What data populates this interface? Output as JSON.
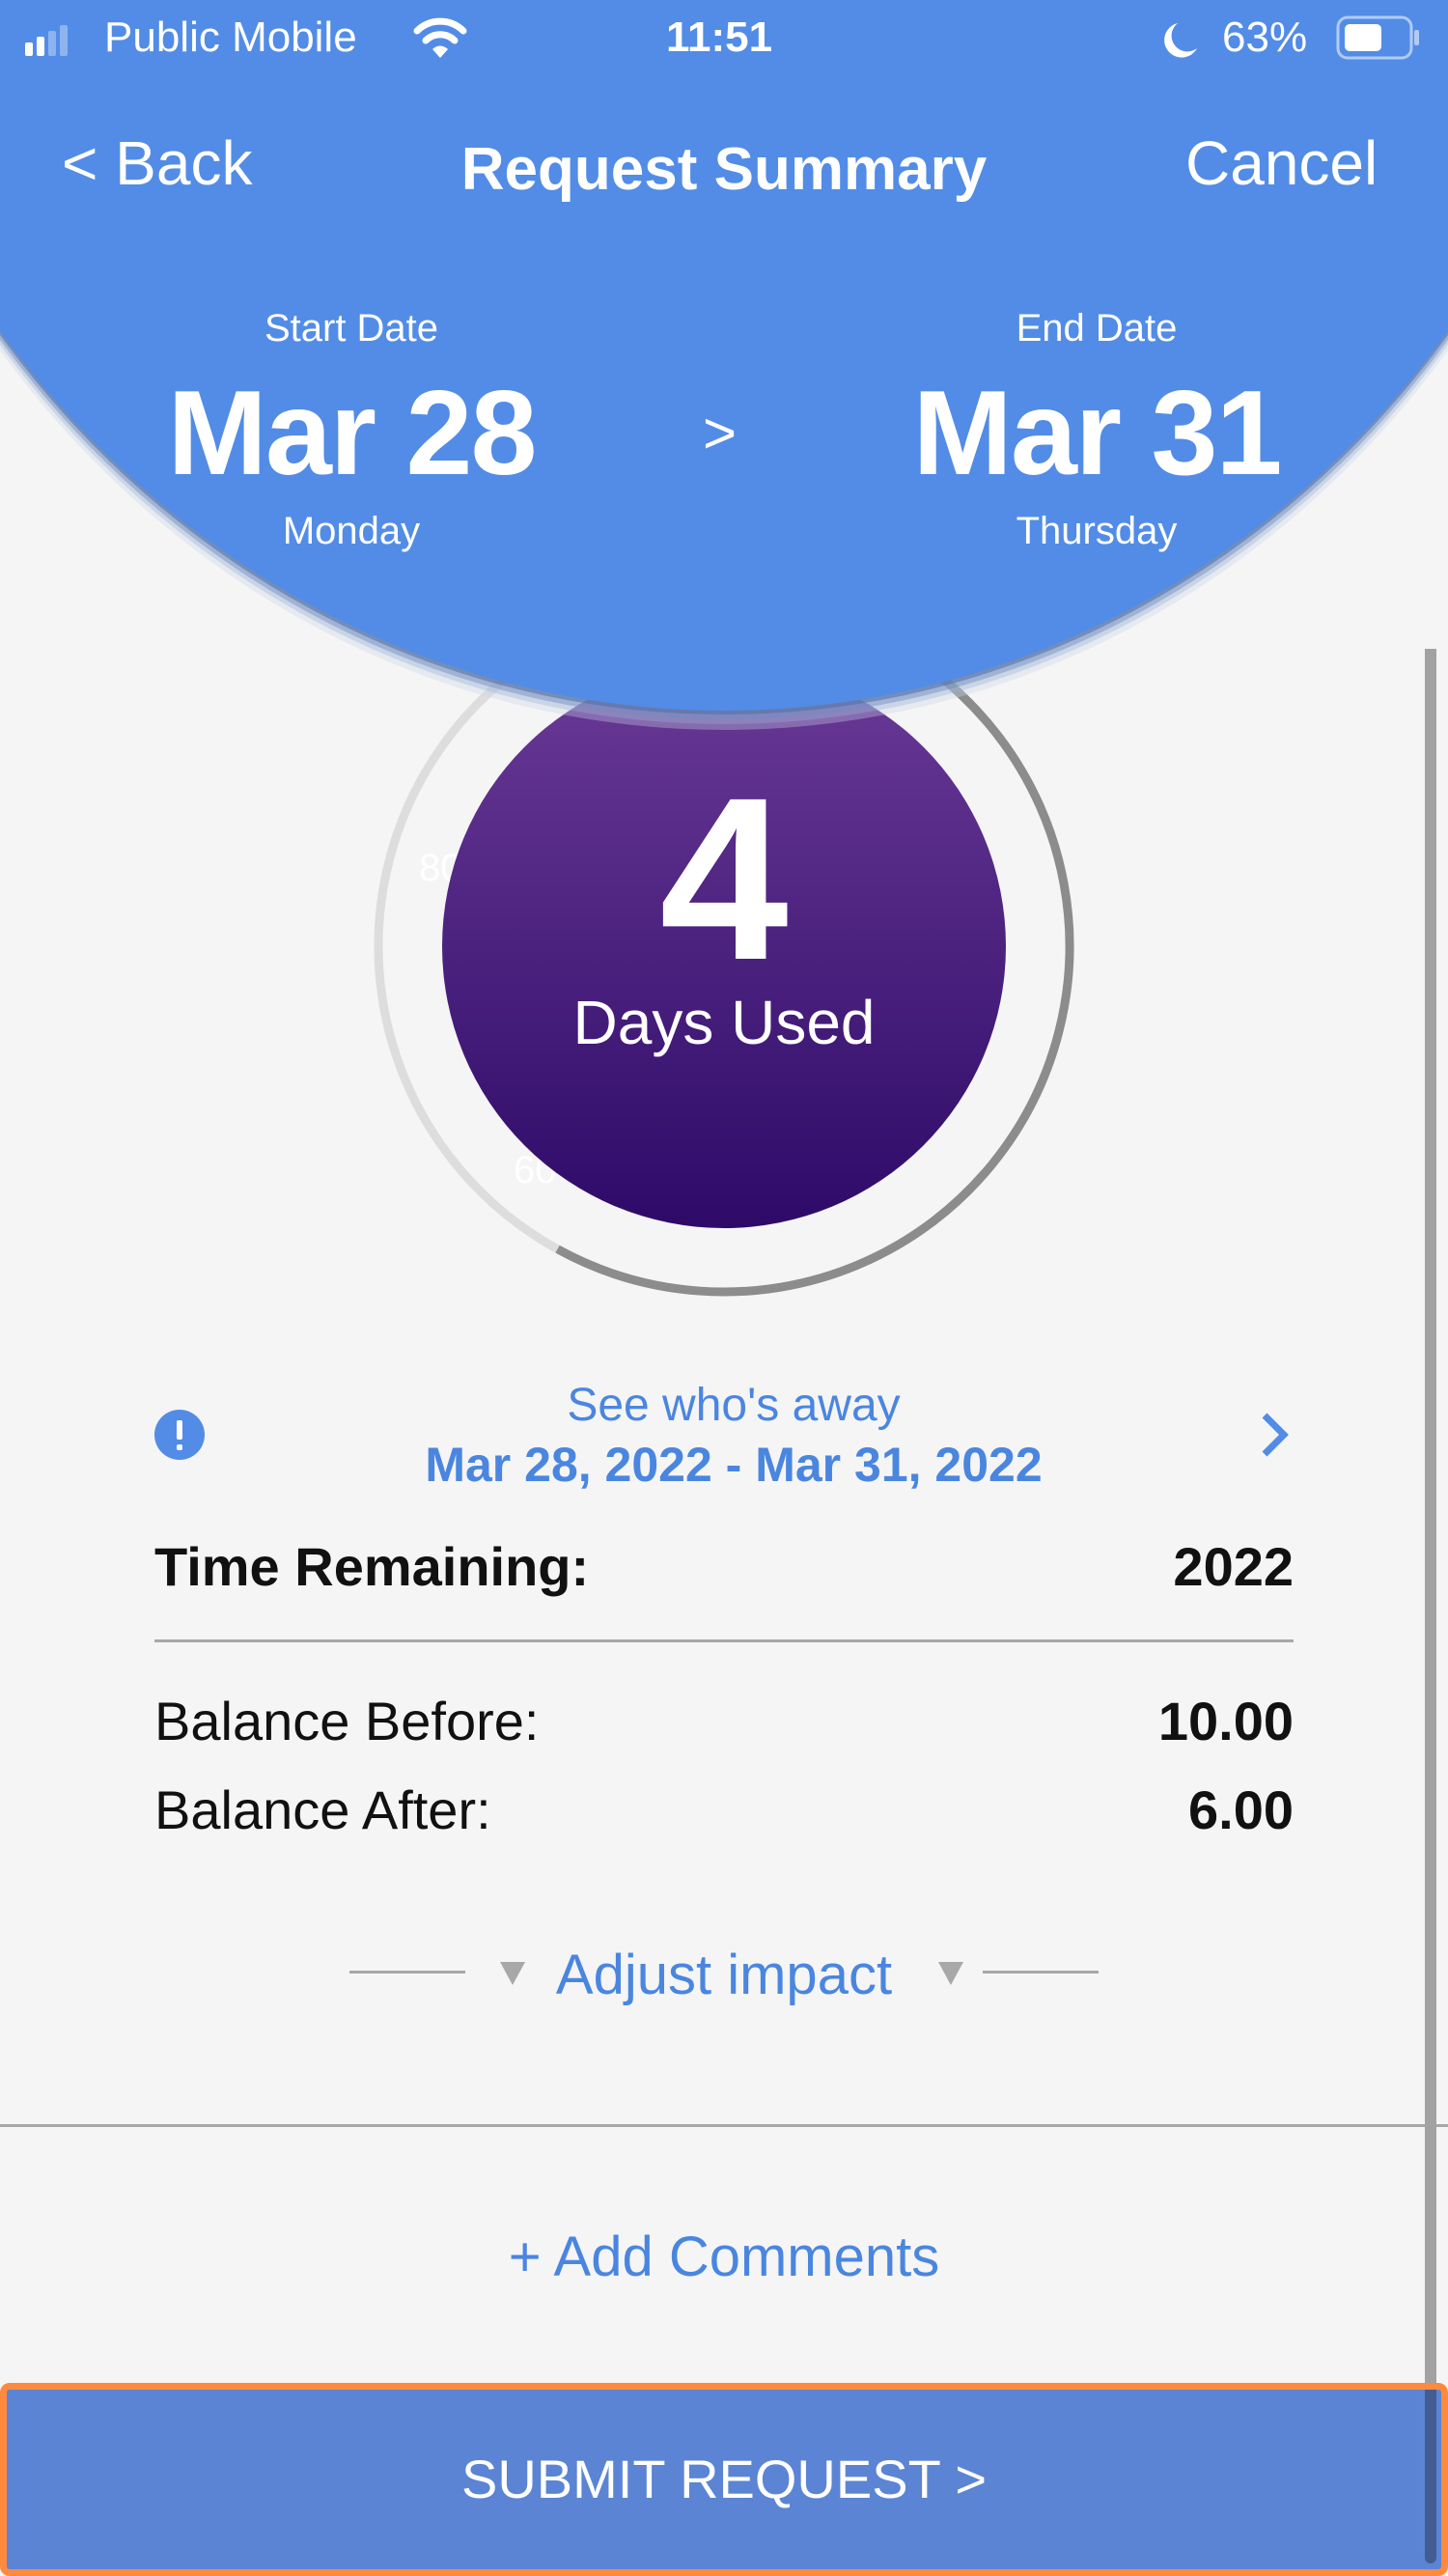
{
  "status_bar": {
    "carrier": "Public Mobile",
    "time": "11:51",
    "battery_percent": "63%",
    "battery_level": 0.63,
    "signal_bars_active": 2,
    "signal_bars_total": 4
  },
  "nav": {
    "back_label": "< Back",
    "title": "Request Summary",
    "cancel_label": "Cancel"
  },
  "dates": {
    "start_label": "Start Date",
    "start_date": "Mar 28",
    "start_day": "Monday",
    "arrow": ">",
    "end_label": "End Date",
    "end_date": "Mar 31",
    "end_day": "Thursday"
  },
  "usage": {
    "days_used": "4",
    "days_used_label": "Days Used",
    "ring_tick_labels": [
      "80",
      "60"
    ],
    "ring_light_fraction": 0.42,
    "colors": {
      "ring_light": "#dddddd",
      "ring_dark": "#8c8c8c",
      "circle_top": "#6a3a96",
      "circle_bottom": "#2e0a68"
    }
  },
  "whos_away": {
    "title": "See who's away",
    "range": "Mar 28, 2022 - Mar 31, 2022"
  },
  "time_remaining": {
    "label": "Time Remaining:",
    "value": "2022"
  },
  "balances": [
    {
      "label": "Balance Before:",
      "value": "10.00"
    },
    {
      "label": "Balance After:",
      "value": "6.00"
    }
  ],
  "adjust_impact_label": "Adjust impact",
  "add_comments_label": "+ Add Comments",
  "submit_label": "SUBMIT REQUEST >",
  "colors": {
    "header_blue": "#528ce6",
    "link_blue": "#4a86e0",
    "submit_blue": "#5b84d4",
    "focus_orange": "#ff8a3d"
  }
}
